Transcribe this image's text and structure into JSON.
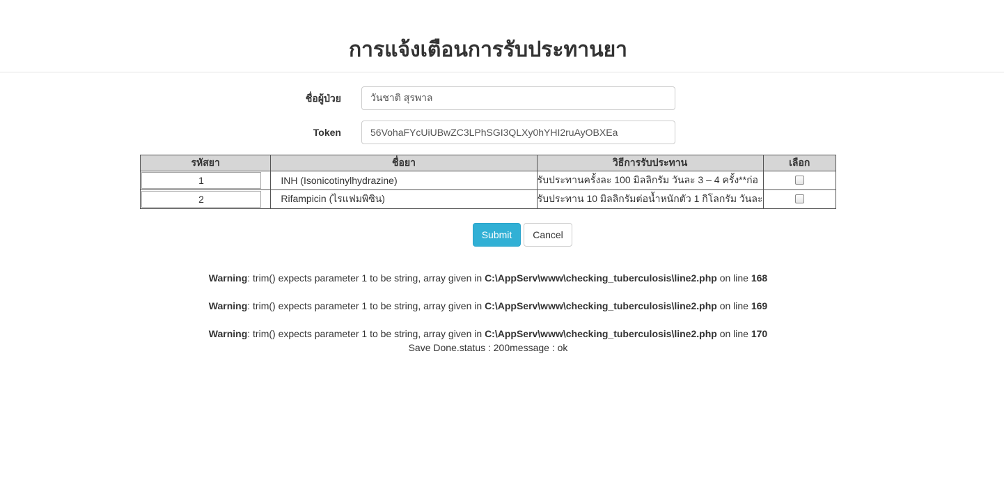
{
  "page": {
    "title": "การแจ้งเตือนการรับประทานยา"
  },
  "form": {
    "patient_label": "ชื่อผู้ป่วย",
    "patient_value": "วันชาติ สุรพาล",
    "token_label": "Token",
    "token_value": "56VohaFYcUiUBwZC3LPhSGI3QLXy0hYHI2ruAyOBXEa"
  },
  "table": {
    "headers": {
      "code": "รหัสยา",
      "name": "ชื่อยา",
      "method": "วิธีการรับประทาน",
      "select": "เลือก"
    },
    "rows": [
      {
        "code": "1",
        "name": "INH (Isonicotinylhydrazine)",
        "method": "รับประทานครั้งละ 100 มิลลิกรัม วันละ 3 – 4 ครั้ง**ก่อ",
        "selected": false
      },
      {
        "code": "2",
        "name": "Rifampicin (ไรแฟมพิซิน)",
        "method": "รับประทาน 10 มิลลิกรัมต่อน้ำหนักตัว 1 กิโลกรัม วันละ",
        "selected": false
      }
    ]
  },
  "buttons": {
    "submit": "Submit",
    "cancel": "Cancel"
  },
  "warnings": [
    {
      "prefix": "Warning",
      "message": ": trim() expects parameter 1 to be string, array given in ",
      "file": "C:\\AppServ\\www\\checking_tuberculosis\\line2.php",
      "on_line": " on line ",
      "line": "168"
    },
    {
      "prefix": "Warning",
      "message": ": trim() expects parameter 1 to be string, array given in ",
      "file": "C:\\AppServ\\www\\checking_tuberculosis\\line2.php",
      "on_line": " on line ",
      "line": "169"
    },
    {
      "prefix": "Warning",
      "message": ": trim() expects parameter 1 to be string, array given in ",
      "file": "C:\\AppServ\\www\\checking_tuberculosis\\line2.php",
      "on_line": " on line ",
      "line": "170"
    }
  ],
  "status": {
    "save_message": "Save Done.status : 200message : ok"
  },
  "colors": {
    "submit_bg": "#31b0d5",
    "header_bg": "#d6d6d6",
    "text": "#333333"
  }
}
